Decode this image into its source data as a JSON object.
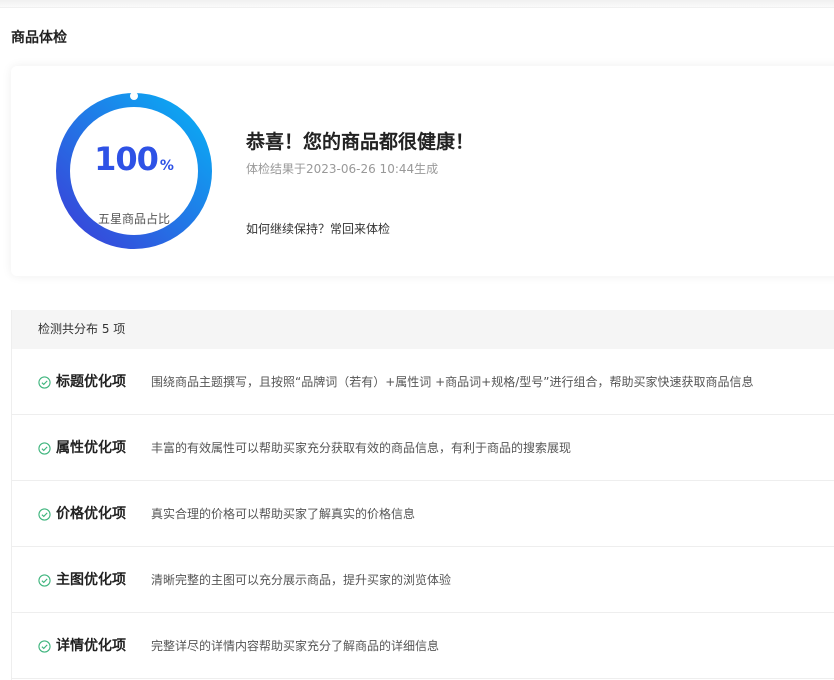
{
  "page": {
    "title": "商品体检"
  },
  "summary": {
    "gauge": {
      "value": "100",
      "unit": "%",
      "label": "五星商品占比",
      "percent": 100
    },
    "headline": "恭喜！您的商品都很健康！",
    "timestamp": "体检结果于2023-06-26 10:44生成",
    "tip": "如何继续保持？常回来体检"
  },
  "checks": {
    "header": "检测共分布 5 项",
    "items": [
      {
        "title": "标题优化项",
        "desc": "围绕商品主题撰写，且按照“品牌词（若有）+属性词 +商品词+规格/型号”进行组合，帮助买家快速获取商品信息"
      },
      {
        "title": "属性优化项",
        "desc": "丰富的有效属性可以帮助买家充分获取有效的商品信息，有利于商品的搜索展现"
      },
      {
        "title": "价格优化项",
        "desc": "真实合理的价格可以帮助买家了解真实的价格信息"
      },
      {
        "title": "主图优化项",
        "desc": "清晰完整的主图可以充分展示商品，提升买家的浏览体验"
      },
      {
        "title": "详情优化项",
        "desc": "完整详尽的详情内容帮助买家充分了解商品的详细信息"
      }
    ]
  },
  "colors": {
    "gradient_start": "#3b3fd8",
    "gradient_end": "#08b0f5",
    "ok": "#3fb57e"
  },
  "icons": {
    "ok": "check-circle-icon"
  }
}
